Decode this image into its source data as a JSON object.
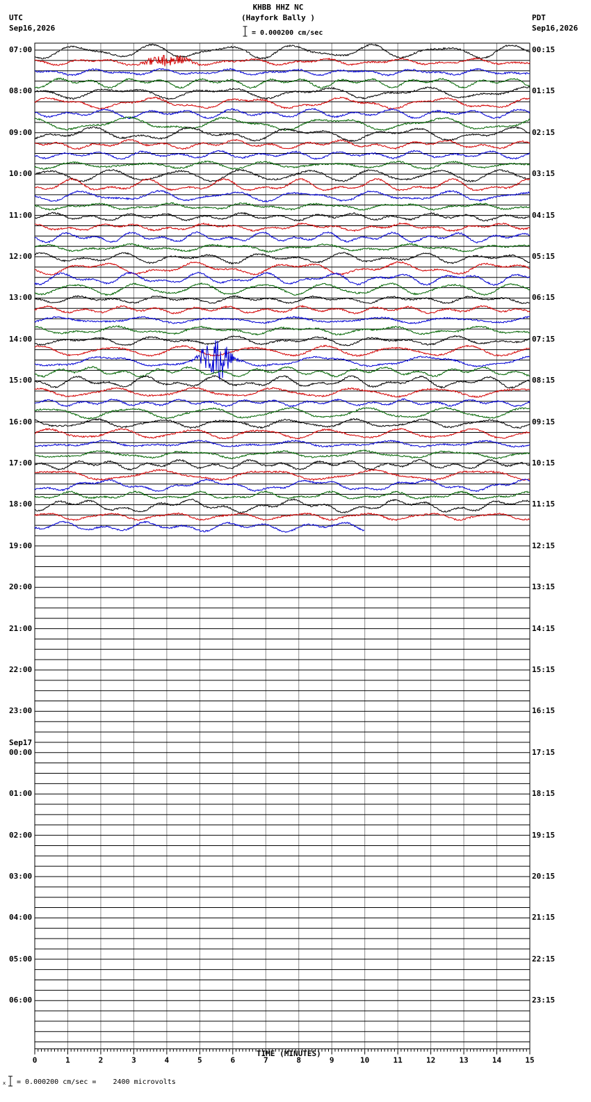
{
  "header": {
    "station": "KHBB HHZ NC",
    "location": "(Hayfork Bally )",
    "scale_text": "= 0.000200 cm/sec",
    "left_tz": "UTC",
    "left_date": "Sep16,2026",
    "right_tz": "PDT",
    "right_date": "Sep16,2026"
  },
  "footer": {
    "scale_note": "= 0.000200 cm/sec =    2400 microvolts",
    "x_label": "TIME (MINUTES)"
  },
  "chart_data": {
    "type": "line",
    "title": "KHBB HHZ NC (Hayfork Bally )",
    "xlabel": "TIME (MINUTES)",
    "x_ticks": [
      "0",
      "1",
      "2",
      "3",
      "4",
      "5",
      "6",
      "7",
      "8",
      "9",
      "10",
      "11",
      "12",
      "13",
      "14",
      "15"
    ],
    "xlim": [
      0,
      15
    ],
    "rows_per_hour": 4,
    "left_labels": [
      {
        "hour": 0,
        "text": "07:00"
      },
      {
        "hour": 1,
        "text": "08:00"
      },
      {
        "hour": 2,
        "text": "09:00"
      },
      {
        "hour": 3,
        "text": "10:00"
      },
      {
        "hour": 4,
        "text": "11:00"
      },
      {
        "hour": 5,
        "text": "12:00"
      },
      {
        "hour": 6,
        "text": "13:00"
      },
      {
        "hour": 7,
        "text": "14:00"
      },
      {
        "hour": 8,
        "text": "15:00"
      },
      {
        "hour": 9,
        "text": "16:00"
      },
      {
        "hour": 10,
        "text": "17:00"
      },
      {
        "hour": 11,
        "text": "18:00"
      },
      {
        "hour": 12,
        "text": "19:00"
      },
      {
        "hour": 13,
        "text": "20:00"
      },
      {
        "hour": 14,
        "text": "21:00"
      },
      {
        "hour": 15,
        "text": "22:00"
      },
      {
        "hour": 16,
        "text": "23:00"
      },
      {
        "hour": 17,
        "text": "00:00",
        "date": "Sep17"
      },
      {
        "hour": 18,
        "text": "01:00"
      },
      {
        "hour": 19,
        "text": "02:00"
      },
      {
        "hour": 20,
        "text": "03:00"
      },
      {
        "hour": 21,
        "text": "04:00"
      },
      {
        "hour": 22,
        "text": "05:00"
      },
      {
        "hour": 23,
        "text": "06:00"
      }
    ],
    "right_labels": [
      "00:15",
      "01:15",
      "02:15",
      "03:15",
      "04:15",
      "05:15",
      "06:15",
      "07:15",
      "08:15",
      "09:15",
      "10:15",
      "11:15",
      "12:15",
      "13:15",
      "14:15",
      "15:15",
      "16:15",
      "17:15",
      "18:15",
      "19:15",
      "20:15",
      "21:15",
      "22:15",
      "23:15"
    ],
    "trace_colors": [
      "#000000",
      "#d40000",
      "#0000d4",
      "#006400"
    ],
    "trace_rows": 47,
    "last_row_end_minute": 10,
    "events": [
      {
        "row": 1,
        "minute": 4.0,
        "amplitude": "large",
        "color": "#d40000"
      },
      {
        "row": 30,
        "minute": 5.5,
        "amplitude": "very large",
        "color": "#0000d4"
      }
    ],
    "grid": true
  }
}
